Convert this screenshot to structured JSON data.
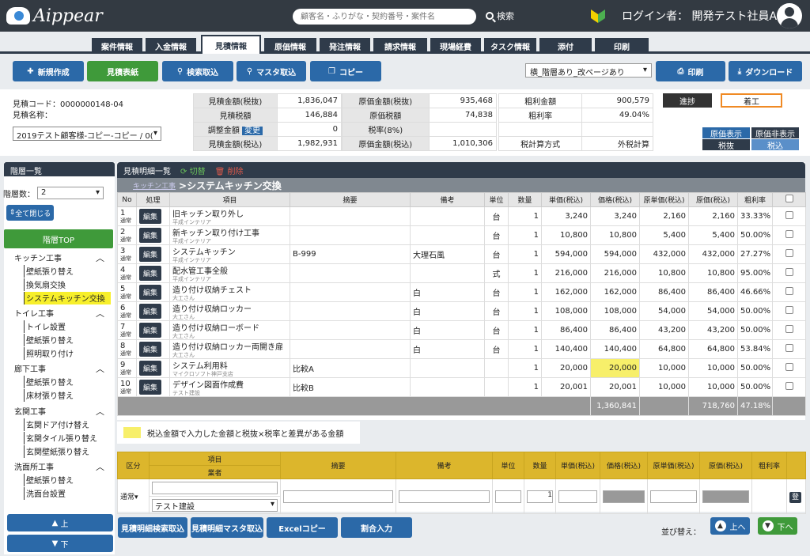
{
  "app": {
    "logo_text": "Aippear",
    "search_placeholder": "顧客名・ふりがな・契約番号・案件名",
    "search_label": "検索",
    "login_label": "ログイン者：",
    "user_name": "開発テスト社員A"
  },
  "tabs": [
    "案件情報",
    "入金情報",
    "見積情報",
    "原価情報",
    "発注情報",
    "請求情報",
    "現場経費",
    "タスク情報",
    "添付",
    "印刷"
  ],
  "toolbar": {
    "new": "新規作成",
    "cover": "見積表紙",
    "search_import": "検索取込",
    "master_import": "マスタ取込",
    "copy": "コピー",
    "layout_select": "横_階層あり_改ページあり",
    "print": "印刷",
    "download": "ダウンロード"
  },
  "summary": {
    "code_label": "見積コード：",
    "code": "0000000148-04",
    "name_label": "見積名称：",
    "name": "2019テスト顧客様-コピー-コピー / 0(",
    "amount_ex_label": "見積金額(税抜)",
    "amount_ex": "1,836,047",
    "tax_label": "見積税額",
    "tax": "146,884",
    "adjust_label": "調整金額",
    "adjust_btn": "変更",
    "adjust": "0",
    "amount_in_label": "見積金額(税込)",
    "amount_in": "1,982,931",
    "cost_ex_label": "原価金額(税抜)",
    "cost_ex": "935,468",
    "cost_tax_label": "原価税額",
    "cost_tax": "74,838",
    "tax_rate_label": "税率(8%)",
    "cost_in_label": "原価金額(税込)",
    "cost_in": "1,010,306",
    "gross_label": "粗利金額",
    "gross": "900,579",
    "gross_rate_label": "粗利率",
    "gross_rate": "49.04%",
    "calc_label": "税計算方式",
    "calc": "外税計算",
    "progress_label": "進捗",
    "progress": "着工",
    "cost_show": "原価表示",
    "cost_hide": "原価非表示",
    "tax_ex": "税抜",
    "tax_in": "税込"
  },
  "sidebar": {
    "title": "階層一覧",
    "layers_label": "階層数：",
    "layers_value": "2",
    "close_all": "全て閉じる",
    "top": "階層TOP",
    "groups": [
      {
        "label": "キッチン工事",
        "items": [
          "壁紙張り替え",
          "換気扇交換",
          "システムキッチン交換"
        ]
      },
      {
        "label": "トイレ工事",
        "items": [
          "トイレ設置",
          "壁紙張り替え",
          "照明取り付け"
        ]
      },
      {
        "label": "廊下工事",
        "items": [
          "壁紙張り替え",
          "床材張り替え"
        ]
      },
      {
        "label": "玄関工事",
        "items": [
          "玄関ドア付け替え",
          "玄関タイル張り替え",
          "玄関壁紙張り替え"
        ]
      },
      {
        "label": "洗面所工事",
        "items": [
          "壁紙張り替え",
          "洗面台設置"
        ]
      }
    ],
    "up": "上",
    "down": "下"
  },
  "detail": {
    "title": "見積明細一覧",
    "switch": "切替",
    "delete": "削除",
    "crumb_link": "キッチン工事",
    "crumb_current": ">システムキッチン交換",
    "headers": [
      "No",
      "処理",
      "項目",
      "摘要",
      "備考",
      "単位",
      "数量",
      "単価(税込)",
      "価格(税込)",
      "原単価(税込)",
      "原価(税込)",
      "粗利率"
    ],
    "edit_label": "編集",
    "rows": [
      {
        "no": "1",
        "kind": "通常",
        "item": "旧キッチン取り外し",
        "sub": "平成インテリア",
        "desc": "",
        "note": "",
        "unit": "台",
        "qty": "1",
        "price": "3,240",
        "amount": "3,240",
        "cunit": "2,160",
        "cost": "2,160",
        "rate": "33.33%"
      },
      {
        "no": "2",
        "kind": "通常",
        "item": "新キッチン取り付け工事",
        "sub": "平成インテリア",
        "desc": "",
        "note": "",
        "unit": "台",
        "qty": "1",
        "price": "10,800",
        "amount": "10,800",
        "cunit": "5,400",
        "cost": "5,400",
        "rate": "50.00%"
      },
      {
        "no": "3",
        "kind": "通常",
        "item": "システムキッチン",
        "sub": "平成インテリア",
        "desc": "B-999",
        "note": "大理石風",
        "unit": "台",
        "qty": "1",
        "price": "594,000",
        "amount": "594,000",
        "cunit": "432,000",
        "cost": "432,000",
        "rate": "27.27%"
      },
      {
        "no": "4",
        "kind": "通常",
        "item": "配水管工事全般",
        "sub": "平成インテリア",
        "desc": "",
        "note": "",
        "unit": "式",
        "qty": "1",
        "price": "216,000",
        "amount": "216,000",
        "cunit": "10,800",
        "cost": "10,800",
        "rate": "95.00%"
      },
      {
        "no": "5",
        "kind": "通常",
        "item": "造り付け収納チェスト",
        "sub": "大工さん",
        "desc": "",
        "note": "白",
        "unit": "台",
        "qty": "1",
        "price": "162,000",
        "amount": "162,000",
        "cunit": "86,400",
        "cost": "86,400",
        "rate": "46.66%"
      },
      {
        "no": "6",
        "kind": "通常",
        "item": "造り付け収納ロッカー",
        "sub": "大工さん",
        "desc": "",
        "note": "白",
        "unit": "台",
        "qty": "1",
        "price": "108,000",
        "amount": "108,000",
        "cunit": "54,000",
        "cost": "54,000",
        "rate": "50.00%"
      },
      {
        "no": "7",
        "kind": "通常",
        "item": "造り付け収納ローボード",
        "sub": "大工さん",
        "desc": "",
        "note": "白",
        "unit": "台",
        "qty": "1",
        "price": "86,400",
        "amount": "86,400",
        "cunit": "43,200",
        "cost": "43,200",
        "rate": "50.00%"
      },
      {
        "no": "8",
        "kind": "通常",
        "item": "造り付け収納ロッカー両開き扉",
        "sub": "大工さん",
        "desc": "",
        "note": "白",
        "unit": "台",
        "qty": "1",
        "price": "140,400",
        "amount": "140,400",
        "cunit": "64,800",
        "cost": "64,800",
        "rate": "53.84%"
      },
      {
        "no": "9",
        "kind": "通常",
        "item": "システム利用料",
        "sub": "マイクロソフト神戸支店",
        "desc": "比較A",
        "note": "",
        "unit": "",
        "qty": "1",
        "price": "20,000",
        "amount": "20,000",
        "cunit": "10,000",
        "cost": "10,000",
        "rate": "50.00%"
      },
      {
        "no": "10",
        "kind": "通常",
        "item": "デザイン図面作成費",
        "sub": "テスト建設",
        "desc": "比較B",
        "note": "",
        "unit": "",
        "qty": "1",
        "price": "20,001",
        "amount": "20,001",
        "cunit": "10,000",
        "cost": "10,000",
        "rate": "50.00%"
      }
    ],
    "total_amount": "1,360,841",
    "total_cost": "718,760",
    "total_rate": "47.18%"
  },
  "legend": "税込金額で入力した金額と税抜×税率と差異がある金額",
  "entry": {
    "headers": [
      "区分",
      "項目",
      "業者",
      "摘要",
      "備考",
      "単位",
      "数量",
      "単価(税込)",
      "価格(税込)",
      "原単価(税込)",
      "原価(税込)",
      "粗利率"
    ],
    "kind": "通常",
    "vendor": "テスト建設",
    "qty": "1",
    "register": "登"
  },
  "bottom": {
    "b1": "見積明細検索取込",
    "b2": "見積明細マスタ取込",
    "b3": "Excelコピー",
    "b4": "割合入力",
    "sort_label": "並び替え：",
    "up": "上へ",
    "down": "下へ"
  }
}
